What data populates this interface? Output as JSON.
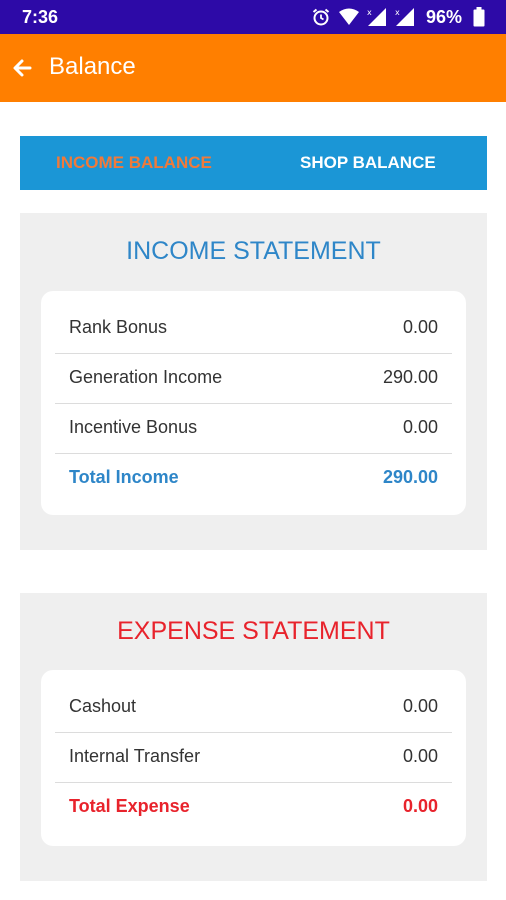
{
  "status_bar": {
    "time": "7:36",
    "battery_percent": "96%",
    "icons": [
      "alarm-icon",
      "wifi-icon",
      "signal-icon",
      "signal-icon",
      "battery-icon"
    ]
  },
  "app_bar": {
    "title": "Balance",
    "back_icon": "arrow-back-icon",
    "color": "#ff7f00"
  },
  "tabs": {
    "income": "INCOME BALANCE",
    "shop": "SHOP BALANCE"
  },
  "income_statement": {
    "title": "INCOME STATEMENT",
    "rows": [
      {
        "label": "Rank Bonus",
        "value": "0.00"
      },
      {
        "label": "Generation Income",
        "value": "290.00"
      },
      {
        "label": "Incentive Bonus",
        "value": "0.00"
      }
    ],
    "total": {
      "label": "Total Income",
      "value": "290.00"
    }
  },
  "expense_statement": {
    "title": "EXPENSE STATEMENT",
    "rows": [
      {
        "label": "Cashout",
        "value": "0.00"
      },
      {
        "label": "Internal Transfer",
        "value": "0.00"
      }
    ],
    "total": {
      "label": "Total Expense",
      "value": "0.00"
    }
  },
  "colors": {
    "status_bar": "#2d0aa7",
    "tab_bar": "#1b96d6",
    "income_accent": "#2e86c8",
    "expense_accent": "#e8232c",
    "active_tab_text": "#f07a3a"
  }
}
